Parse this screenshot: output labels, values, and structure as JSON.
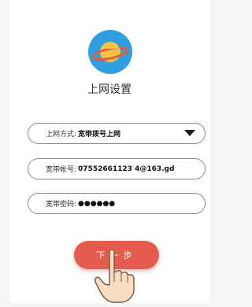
{
  "title": "上网设置",
  "fields": {
    "connection": {
      "label": "上网方式:",
      "value": "宽带拨号上网"
    },
    "account": {
      "label": "宽带帐号:",
      "value": "07552661123 4@163.gd"
    },
    "password": {
      "label": "宽带密码:",
      "value": "●●●●●●"
    }
  },
  "next_button": {
    "label": "下一步"
  },
  "icons": {
    "logo": "planet-icon",
    "dropdown": "caret-down-icon",
    "pointer": "hand-pointer-icon"
  },
  "colors": {
    "logo_bg": "#2f9fe0",
    "planet": "#f6c342",
    "ring": "#e85a38",
    "button": "#e55b4e",
    "hand": "#f7dcc0"
  }
}
